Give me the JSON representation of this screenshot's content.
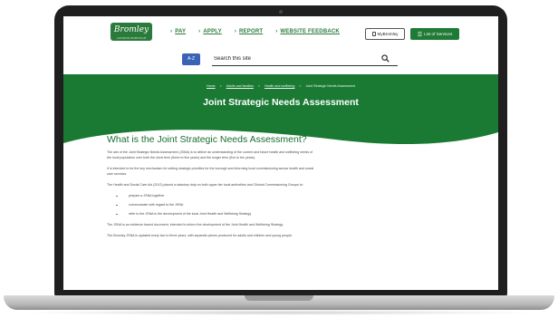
{
  "colors": {
    "brand_green": "#1a7a34",
    "link_green": "#2a7a3b",
    "az_blue": "#3a62b5"
  },
  "header": {
    "logo": {
      "name": "Bromley",
      "tagline": "LONDON BOROUGH"
    },
    "nav_items": [
      "PAY",
      "APPLY",
      "REPORT",
      "WEBSITE FEEDBACK"
    ],
    "account_button": {
      "label": "MyBromley",
      "icon": "account-icon"
    },
    "services_button": {
      "label": "List of Services",
      "icon": "menu-icon"
    }
  },
  "search": {
    "az_label": "A-Z",
    "placeholder": "Search this site",
    "icon": "search-icon"
  },
  "hero": {
    "breadcrumb": [
      "Home",
      "Adults and families",
      "Health and wellbeing",
      "Joint Strategic Needs Assessment"
    ],
    "title": "Joint Strategic Needs Assessment"
  },
  "content": {
    "heading": "What is the Joint Strategic Needs Assessment?",
    "para1": "The aim of the Joint Strategic Needs Assessment (JSNA) is to deliver an understanding of the current and future health and wellbeing needs of the local population over both the short term (three to five years) and the longer term (five to ten years).",
    "para2": "It is intended to be the key mechanism for setting strategic priorities for the borough and informing local commissioning across health and social care services.",
    "para3": "The Health and Social Care Act (2012) placed a statutory duty on both upper tier local authorities and Clinical Commissioning Groups to:",
    "bullets": [
      "prepare a JSNA together",
      "communicate with regard to the JSNA",
      "refer to the JSNA in the development of the local Joint Health and Wellbeing Strategy"
    ],
    "para4": "The JSNA is an evidence based document, intended to inform the development of the Joint Health and Wellbeing Strategy.",
    "para5": "The Bromley JSNA is updated every two to three years, with separate pieces produced for adults and children and young people."
  }
}
